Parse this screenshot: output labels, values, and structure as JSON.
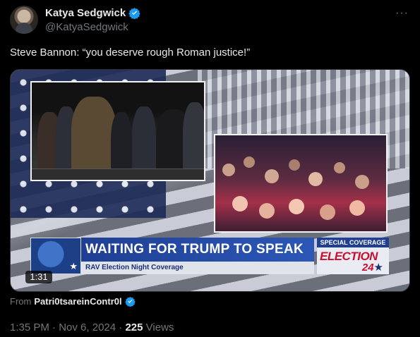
{
  "author": {
    "display_name": "Katya Sedgwick",
    "handle": "@KatyaSedgwick",
    "verified": true,
    "verified_color": "#1d9bf0"
  },
  "menu_icon": "more-horizontal-icon",
  "tweet": {
    "text": "Steve Bannon: “you deserve rough Roman justice!”"
  },
  "video": {
    "duration": "1:31",
    "lower_third": {
      "headline": "WAITING FOR TRUMP TO SPEAK",
      "subheadline": "RAV Election Night Coverage",
      "special_label": "SPECIAL COVERAGE",
      "election_label": "ELECTION",
      "election_number": "24"
    }
  },
  "source": {
    "prefix": "From",
    "name": "Patri0tsareinContr0l",
    "verified": true
  },
  "meta": {
    "time": "1:35 PM",
    "separator": "·",
    "date": "Nov 6, 2024",
    "views_count": "225",
    "views_label": "Views"
  },
  "colors": {
    "background": "#000000",
    "text_primary": "#e7e9ea",
    "text_secondary": "#71767b",
    "accent": "#1d9bf0",
    "banner_blue": "#1f3f93",
    "banner_red": "#c8102e"
  }
}
